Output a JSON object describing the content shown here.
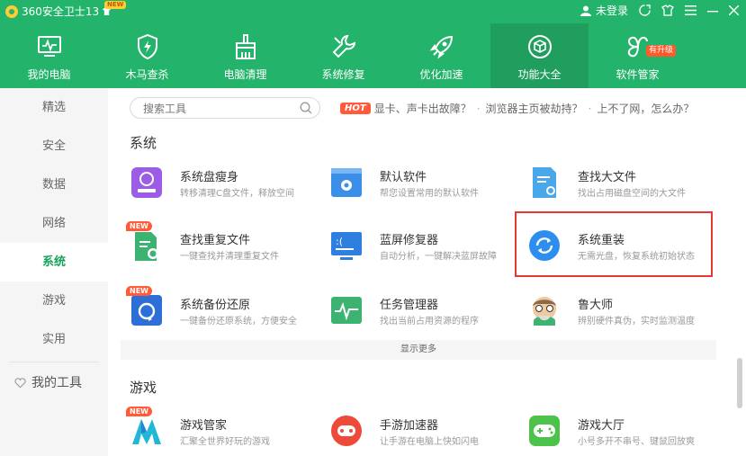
{
  "titlebar": {
    "app_title": "360安全卫士13",
    "new_badge": "NEW",
    "login_text": "未登录"
  },
  "nav": {
    "items": [
      {
        "label": "我的电脑",
        "icon": "monitor-icon"
      },
      {
        "label": "木马查杀",
        "icon": "shield-lightning-icon"
      },
      {
        "label": "电脑清理",
        "icon": "broom-icon"
      },
      {
        "label": "系统修复",
        "icon": "wrench-icon"
      },
      {
        "label": "优化加速",
        "icon": "rocket-icon"
      },
      {
        "label": "功能大全",
        "icon": "cube-icon",
        "active": true
      },
      {
        "label": "软件管家",
        "icon": "clover-icon"
      }
    ],
    "upgrade_badge": "有升级"
  },
  "sidebar": {
    "items": [
      {
        "label": "精选"
      },
      {
        "label": "安全"
      },
      {
        "label": "数据"
      },
      {
        "label": "网络"
      },
      {
        "label": "系统",
        "active": true
      },
      {
        "label": "游戏"
      },
      {
        "label": "实用"
      }
    ],
    "my_tools": "我的工具"
  },
  "search": {
    "placeholder": "搜索工具"
  },
  "hot": {
    "badge": "HOT",
    "links": [
      "显卡、声卡出故障？",
      "浏览器主页被劫持？",
      "上不了网，怎么办？"
    ],
    "separator": "·"
  },
  "sections": {
    "system_title": "系统",
    "game_title": "游戏",
    "show_more": "显示更多"
  },
  "system_tools": [
    {
      "name": "系统盘瘦身",
      "desc": "转移清理C盘文件，释放空间",
      "icon": "disk-icon",
      "new": false
    },
    {
      "name": "默认软件",
      "desc": "帮您设置常用的默认软件",
      "icon": "settings-window-icon",
      "new": false
    },
    {
      "name": "查找大文件",
      "desc": "找出占用磁盘空间的大文件",
      "icon": "file-search-icon",
      "new": false
    },
    {
      "name": "查找重复文件",
      "desc": "一键查找并清理重复文件",
      "icon": "duplicate-file-icon",
      "new": true
    },
    {
      "name": "蓝屏修复器",
      "desc": "自动分析，一键解决蓝屏故障",
      "icon": "bluescreen-icon",
      "new": false
    },
    {
      "name": "系统重装",
      "desc": "无需光盘，恢复系统初始状态",
      "icon": "refresh-icon",
      "new": false
    },
    {
      "name": "系统备份还原",
      "desc": "一键备份还原系统，方便安全",
      "icon": "backup-icon",
      "new": true
    },
    {
      "name": "任务管理器",
      "desc": "找出当前占用资源的程序",
      "icon": "task-monitor-icon",
      "new": false
    },
    {
      "name": "鲁大师",
      "desc": "辨别硬件真伪，实时监测温度",
      "icon": "ludashi-icon",
      "new": false
    }
  ],
  "game_tools": [
    {
      "name": "游戏管家",
      "desc": "汇聚全世界好玩的游戏",
      "icon": "game-manager-icon",
      "new": true
    },
    {
      "name": "手游加速器",
      "desc": "让手游在电脑上快如闪电",
      "icon": "mobile-game-icon",
      "new": false
    },
    {
      "name": "游戏大厅",
      "desc": "小号多开不串号、键鼠回放爽",
      "icon": "gamepad-icon",
      "new": false
    }
  ],
  "new_label": "NEW",
  "colors": {
    "brand_green": "#23b36a",
    "active_nav": "#1f9e5d",
    "highlight_border": "#e53935",
    "hot_red": "#ff5a3a"
  }
}
